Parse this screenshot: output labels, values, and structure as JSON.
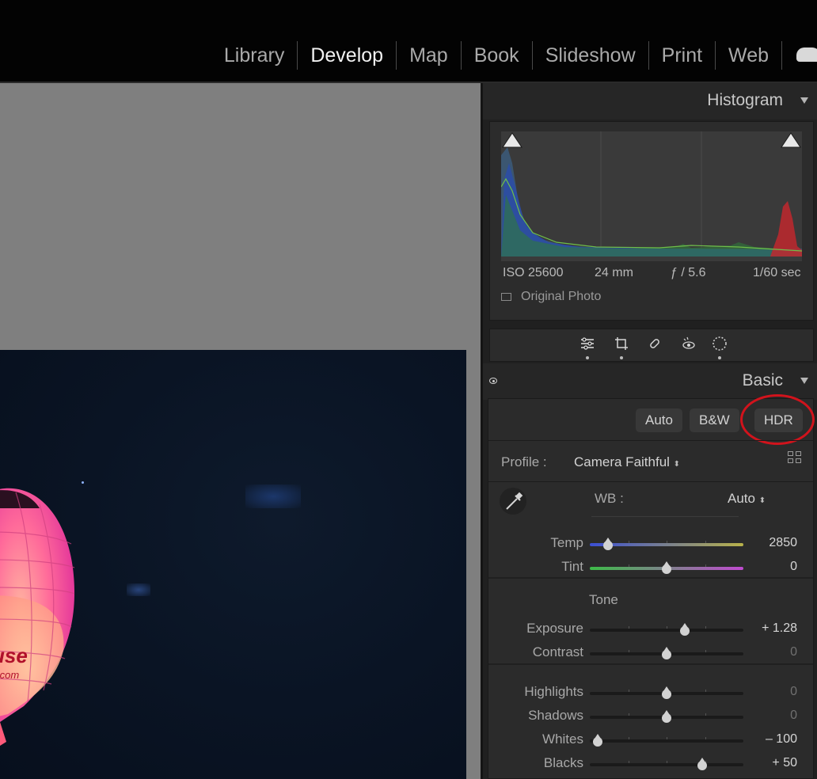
{
  "modules": [
    "Library",
    "Develop",
    "Map",
    "Book",
    "Slideshow",
    "Print",
    "Web"
  ],
  "active_module": "Develop",
  "histogram": {
    "title": "Histogram",
    "exif": {
      "iso": "ISO 25600",
      "focal": "24 mm",
      "aperture": "ƒ / 5.6",
      "shutter": "1/60 sec"
    },
    "original_photo": "Original Photo"
  },
  "basic": {
    "title": "Basic",
    "buttons": {
      "auto": "Auto",
      "bw": "B&W",
      "hdr": "HDR"
    },
    "profile_label": "Profile :",
    "profile_value": "Camera Faithful",
    "wb_label": "WB :",
    "wb_value": "Auto",
    "tone_label": "Tone",
    "sliders": [
      {
        "label": "Temp",
        "value": "2850",
        "pos": 0.12
      },
      {
        "label": "Tint",
        "value": "0",
        "pos": 0.5
      },
      {
        "label": "Exposure",
        "value": "+ 1.28",
        "pos": 0.62
      },
      {
        "label": "Contrast",
        "value": "0",
        "pos": 0.5
      },
      {
        "label": "Highlights",
        "value": "0",
        "pos": 0.5
      },
      {
        "label": "Shadows",
        "value": "0",
        "pos": 0.5
      },
      {
        "label": "Whites",
        "value": "– 100",
        "pos": 0.05
      },
      {
        "label": "Blacks",
        "value": "+ 50",
        "pos": 0.73
      }
    ]
  },
  "colors": {
    "accent_ring": "#d1131c"
  },
  "icons": [
    "cloud-icon",
    "triangle-collapse-icon",
    "eye-icon",
    "sliders-icon",
    "crop-icon",
    "healing-icon",
    "redeye-icon",
    "masking-icon",
    "eyedropper-icon",
    "grid-icon"
  ]
}
